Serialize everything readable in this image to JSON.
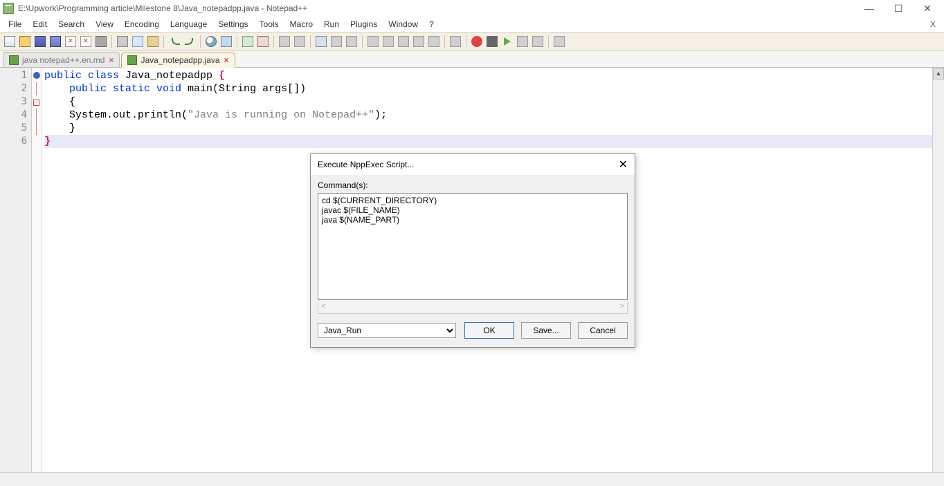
{
  "titlebar": {
    "path": "E:\\Upwork\\Programming article\\Milestone 8\\Java_notepadpp.java - Notepad++"
  },
  "win": {
    "min": "—",
    "max": "☐",
    "close": "✕"
  },
  "menu": {
    "file": "File",
    "edit": "Edit",
    "search": "Search",
    "view": "View",
    "encoding": "Encoding",
    "language": "Language",
    "settings": "Settings",
    "tools": "Tools",
    "macro": "Macro",
    "run": "Run",
    "plugins": "Plugins",
    "window": "Window",
    "help": "?",
    "closex": "X"
  },
  "tabs": [
    {
      "label": "java notepad++.en.md",
      "active": false
    },
    {
      "label": "Java_notepadpp.java",
      "active": true
    }
  ],
  "gutter": [
    "1",
    "2",
    "3",
    "4",
    "5",
    "6"
  ],
  "code": {
    "l1a": "public",
    "l1b": " class",
    "l1c": " Java_notepadpp ",
    "l1d": "{",
    "l2a": "    public",
    "l2b": " static",
    "l2c": " void",
    "l2d": " main(String args[])",
    "l3": "    {",
    "l4a": "    System.out.println(",
    "l4b": "\"Java is running on Notepad++\"",
    "l4c": ");",
    "l5": "    }",
    "l6": "}"
  },
  "dialog": {
    "title": "Execute NppExec Script...",
    "commands_label": "Command(s):",
    "commands_text": "cd $(CURRENT_DIRECTORY)\njavac $(FILE_NAME)\njava $(NAME_PART)",
    "select_value": "Java_Run",
    "ok": "OK",
    "save": "Save...",
    "cancel": "Cancel"
  }
}
